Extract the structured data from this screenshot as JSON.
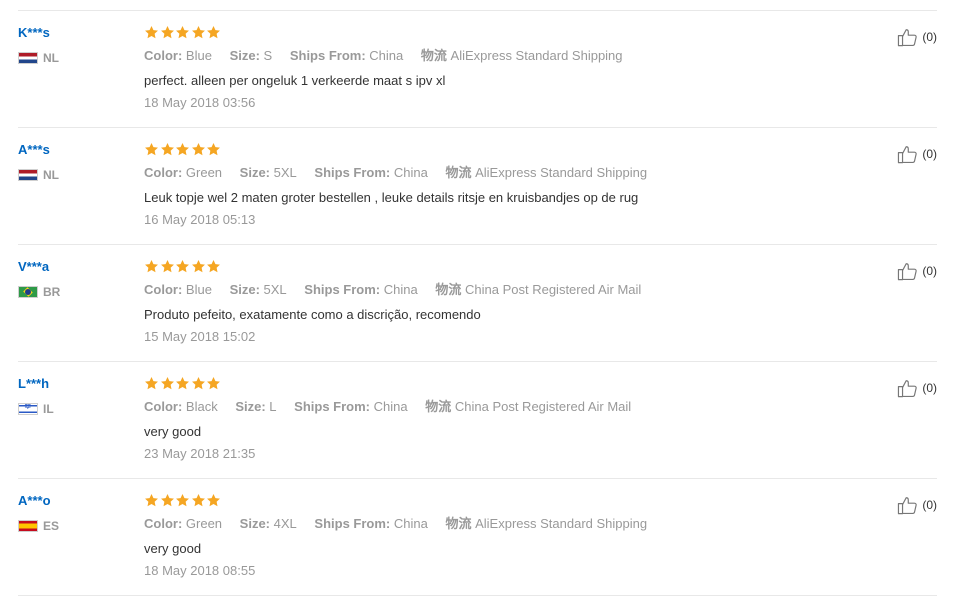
{
  "reviews": [
    {
      "user": "K***s",
      "country_code": "NL",
      "flag": "nl",
      "rating": 5,
      "color_label": "Color:",
      "color": "Blue",
      "size_label": "Size:",
      "size": "S",
      "ships_label": "Ships From:",
      "ships_from": "China",
      "logistics_label": "物流",
      "logistics": "AliExpress Standard Shipping",
      "comment": "perfect. alleen per ongeluk 1 verkeerde maat s ipv xl",
      "date": "18 May 2018 03:56",
      "helpful_count": "(0)"
    },
    {
      "user": "A***s",
      "country_code": "NL",
      "flag": "nl",
      "rating": 5,
      "color_label": "Color:",
      "color": "Green",
      "size_label": "Size:",
      "size": "5XL",
      "ships_label": "Ships From:",
      "ships_from": "China",
      "logistics_label": "物流",
      "logistics": "AliExpress Standard Shipping",
      "comment": "Leuk topje wel 2 maten groter bestellen , leuke details ritsje en kruisbandjes op de rug",
      "date": "16 May 2018 05:13",
      "helpful_count": "(0)"
    },
    {
      "user": "V***a",
      "country_code": "BR",
      "flag": "br",
      "rating": 5,
      "color_label": "Color:",
      "color": "Blue",
      "size_label": "Size:",
      "size": "5XL",
      "ships_label": "Ships From:",
      "ships_from": "China",
      "logistics_label": "物流",
      "logistics": "China Post Registered Air Mail",
      "comment": "Produto pefeito, exatamente como a discrição, recomendo",
      "date": "15 May 2018 15:02",
      "helpful_count": "(0)"
    },
    {
      "user": "L***h",
      "country_code": "IL",
      "flag": "il",
      "rating": 5,
      "color_label": "Color:",
      "color": "Black",
      "size_label": "Size:",
      "size": "L",
      "ships_label": "Ships From:",
      "ships_from": "China",
      "logistics_label": "物流",
      "logistics": "China Post Registered Air Mail",
      "comment": "very good",
      "date": "23 May 2018 21:35",
      "helpful_count": "(0)"
    },
    {
      "user": "A***o",
      "country_code": "ES",
      "flag": "es",
      "rating": 5,
      "color_label": "Color:",
      "color": "Green",
      "size_label": "Size:",
      "size": "4XL",
      "ships_label": "Ships From:",
      "ships_from": "China",
      "logistics_label": "物流",
      "logistics": "AliExpress Standard Shipping",
      "comment": "very good",
      "date": "18 May 2018 08:55",
      "helpful_count": "(0)"
    }
  ],
  "colors": {
    "username": "#0066c0",
    "star": "#f5a623",
    "muted": "#999999",
    "divider": "#e8e8e8"
  },
  "icons": {
    "star": "star-icon",
    "helpful": "thumbs-up-icon"
  }
}
